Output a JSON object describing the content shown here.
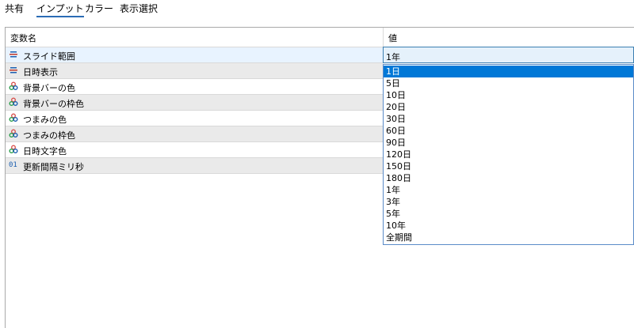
{
  "tabs": [
    {
      "label": "共有"
    },
    {
      "label": "インプット"
    },
    {
      "label": "カラー"
    },
    {
      "label": "表示選択"
    }
  ],
  "table": {
    "headers": {
      "name": "変数名",
      "value": "値"
    },
    "rows": [
      {
        "label": "スライド範囲",
        "icon": "list-icon"
      },
      {
        "label": "日時表示",
        "icon": "list-icon"
      },
      {
        "label": "背景バーの色",
        "icon": "color-icon"
      },
      {
        "label": "背景バーの枠色",
        "icon": "color-icon"
      },
      {
        "label": "つまみの色",
        "icon": "color-icon"
      },
      {
        "label": "つまみの枠色",
        "icon": "color-icon"
      },
      {
        "label": "日時文字色",
        "icon": "color-icon"
      },
      {
        "label": "更新間隔ミリ秒",
        "icon": "integer-icon",
        "icon_text": "01"
      }
    ]
  },
  "combo": {
    "selected": "1年",
    "options": [
      "1日",
      "5日",
      "10日",
      "20日",
      "30日",
      "60日",
      "90日",
      "120日",
      "150日",
      "180日",
      "1年",
      "3年",
      "5年",
      "10年",
      "全期間"
    ],
    "highlighted": "1日"
  },
  "colors": {
    "accent": "#0078d7",
    "tab_underline": "#2a6bb5",
    "alt_row": "#eaeaea",
    "combo_bg": "#e5f1fb"
  }
}
